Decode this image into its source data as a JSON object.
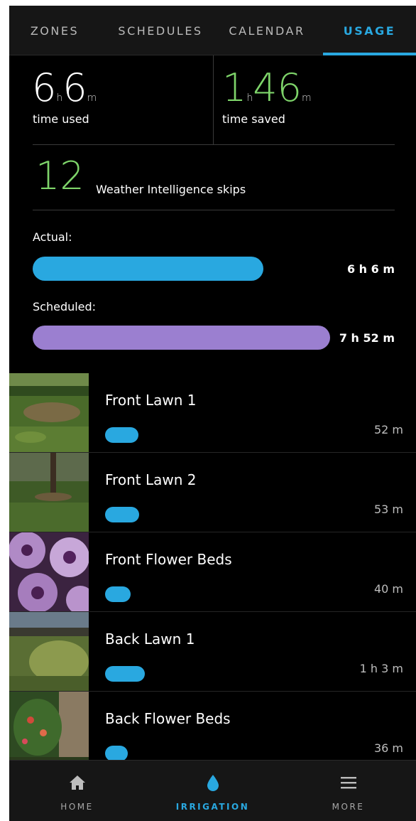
{
  "tabs": [
    {
      "label": "ZONES",
      "active": false
    },
    {
      "label": "SCHEDULES",
      "active": false
    },
    {
      "label": "CALENDAR",
      "active": false
    },
    {
      "label": "USAGE",
      "active": true
    }
  ],
  "stats": {
    "time_used": {
      "hours": "6",
      "hours_unit": "h",
      "minutes": "6",
      "minutes_unit": "m",
      "label": "time used"
    },
    "time_saved": {
      "hours": "1",
      "hours_unit": "h",
      "minutes": "46",
      "minutes_unit": "m",
      "label": "time saved"
    },
    "skips": {
      "count": "12",
      "label": "Weather Intelligence skips"
    }
  },
  "bars": {
    "actual": {
      "label": "Actual:",
      "value": "6 h 6 m",
      "fraction": 0.776
    },
    "scheduled": {
      "label": "Scheduled:",
      "value": "7 h 52 m",
      "fraction": 1.0
    }
  },
  "zones": [
    {
      "name": "Front Lawn 1",
      "time": "52 m",
      "fraction": 0.137,
      "thumb": "lawn"
    },
    {
      "name": "Front Lawn 2",
      "time": "53 m",
      "fraction": 0.14,
      "thumb": "lawn-tree"
    },
    {
      "name": "Front Flower Beds",
      "time": "40 m",
      "fraction": 0.106,
      "thumb": "petunias"
    },
    {
      "name": "Back Lawn 1",
      "time": "1 h 3 m",
      "fraction": 0.166,
      "thumb": "back-lawn"
    },
    {
      "name": "Back Flower Beds",
      "time": "36 m",
      "fraction": 0.095,
      "thumb": "flower-bed"
    }
  ],
  "bottom_nav": [
    {
      "label": "HOME",
      "icon": "home-icon",
      "active": false
    },
    {
      "label": "IRRIGATION",
      "icon": "water-drop-icon",
      "active": true
    },
    {
      "label": "MORE",
      "icon": "menu-icon",
      "active": false
    }
  ],
  "colors": {
    "accent_blue": "#29a8e0",
    "scheduled_purple": "#9b7fd0",
    "saved_green": "#7ed46a"
  }
}
